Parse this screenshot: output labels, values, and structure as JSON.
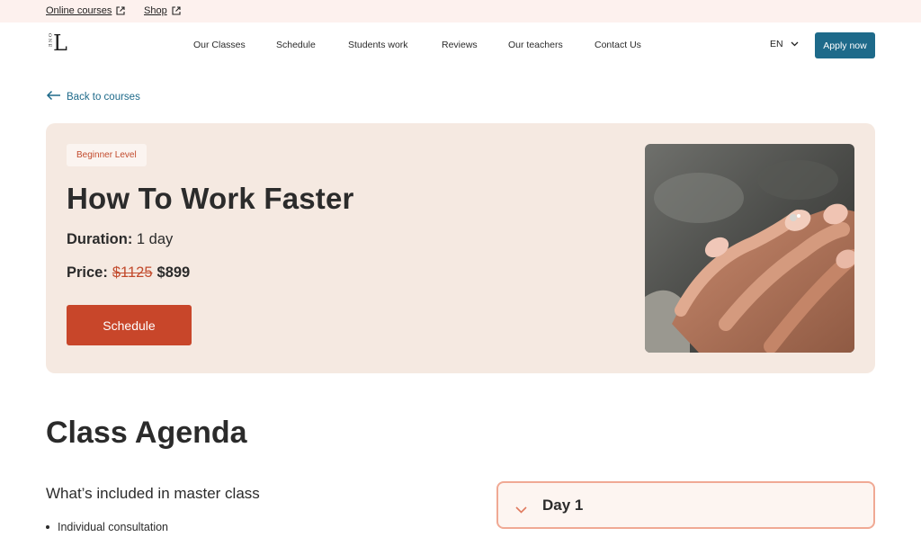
{
  "topbar": {
    "links": [
      {
        "label": "Online courses"
      },
      {
        "label": "Shop"
      }
    ]
  },
  "logo": {
    "stack": "O N E",
    "letter": "L"
  },
  "nav": {
    "items": [
      "Our Classes",
      "Schedule",
      "Students work",
      "Reviews",
      "Our teachers",
      "Contact Us"
    ]
  },
  "language": {
    "value": "EN"
  },
  "apply_label": "Apply now",
  "back_label": "Back to courses",
  "hero": {
    "badge": "Beginner Level",
    "title": "How To Work Faster",
    "duration_label": "Duration:",
    "duration_value": "1 day",
    "price_label": "Price:",
    "price_old": "$1125",
    "price_new": "$899",
    "schedule_label": "Schedule"
  },
  "agenda": {
    "title": "Class Agenda",
    "subtitle": "What’s included in master class",
    "items": [
      "Individual consultation"
    ],
    "day_label": "Day 1"
  },
  "colors": {
    "accent_blue": "#1e6a8a",
    "accent_orange": "#c8462a",
    "hero_bg": "#f5e9e1",
    "topbar_bg": "#fdf1ee"
  }
}
